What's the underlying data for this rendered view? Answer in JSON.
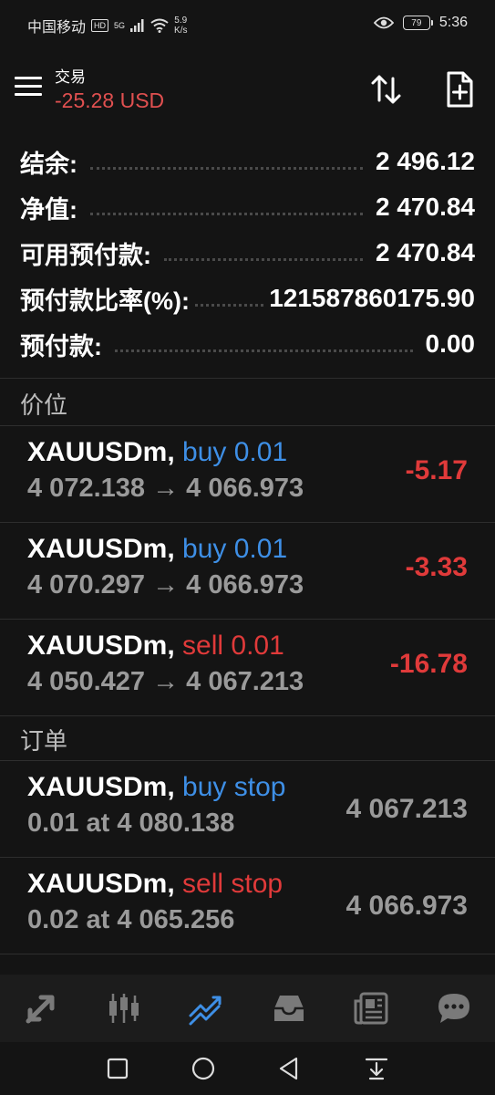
{
  "status_bar": {
    "carrier": "中国移动",
    "hd_badge": "HD",
    "net_type": "5G",
    "speed_value": "5.9",
    "speed_unit": "K/s",
    "battery": "79",
    "time": "5:36"
  },
  "header": {
    "title": "交易",
    "profit": "-25.28 USD"
  },
  "summary": [
    {
      "label": "结余:",
      "value": "2 496.12"
    },
    {
      "label": "净值:",
      "value": "2 470.84"
    },
    {
      "label": "可用预付款:",
      "value": "2 470.84"
    },
    {
      "label": "预付款比率(%):",
      "value": "121587860175.90"
    },
    {
      "label": "预付款:",
      "value": "0.00"
    }
  ],
  "positions": {
    "header": "价位",
    "items": [
      {
        "symbol": "XAUUSDm,",
        "side": "buy 0.01",
        "side_type": "buy",
        "open": "4 072.138",
        "arrow": "→",
        "current": "4 066.973",
        "profit": "-5.17"
      },
      {
        "symbol": "XAUUSDm,",
        "side": "buy 0.01",
        "side_type": "buy",
        "open": "4 070.297",
        "arrow": "→",
        "current": "4 066.973",
        "profit": "-3.33"
      },
      {
        "symbol": "XAUUSDm,",
        "side": "sell 0.01",
        "side_type": "sell",
        "open": "4 050.427",
        "arrow": "→",
        "current": "4 067.213",
        "profit": "-16.78"
      }
    ]
  },
  "orders": {
    "header": "订单",
    "items": [
      {
        "symbol": "XAUUSDm,",
        "type": "buy stop",
        "type_kind": "buy",
        "detail": "0.01 at 4 080.138",
        "price": "4 067.213"
      },
      {
        "symbol": "XAUUSDm,",
        "type": "sell stop",
        "type_kind": "sell",
        "detail": "0.02 at 4 065.256",
        "price": "4 066.973"
      }
    ]
  },
  "bottom_nav": [
    "quotes-icon",
    "chart-icon",
    "trade-icon",
    "history-icon",
    "news-icon",
    "messages-icon"
  ],
  "colors": {
    "accent": "#3e8fe6",
    "loss": "#e03a3a",
    "background": "#141414"
  }
}
